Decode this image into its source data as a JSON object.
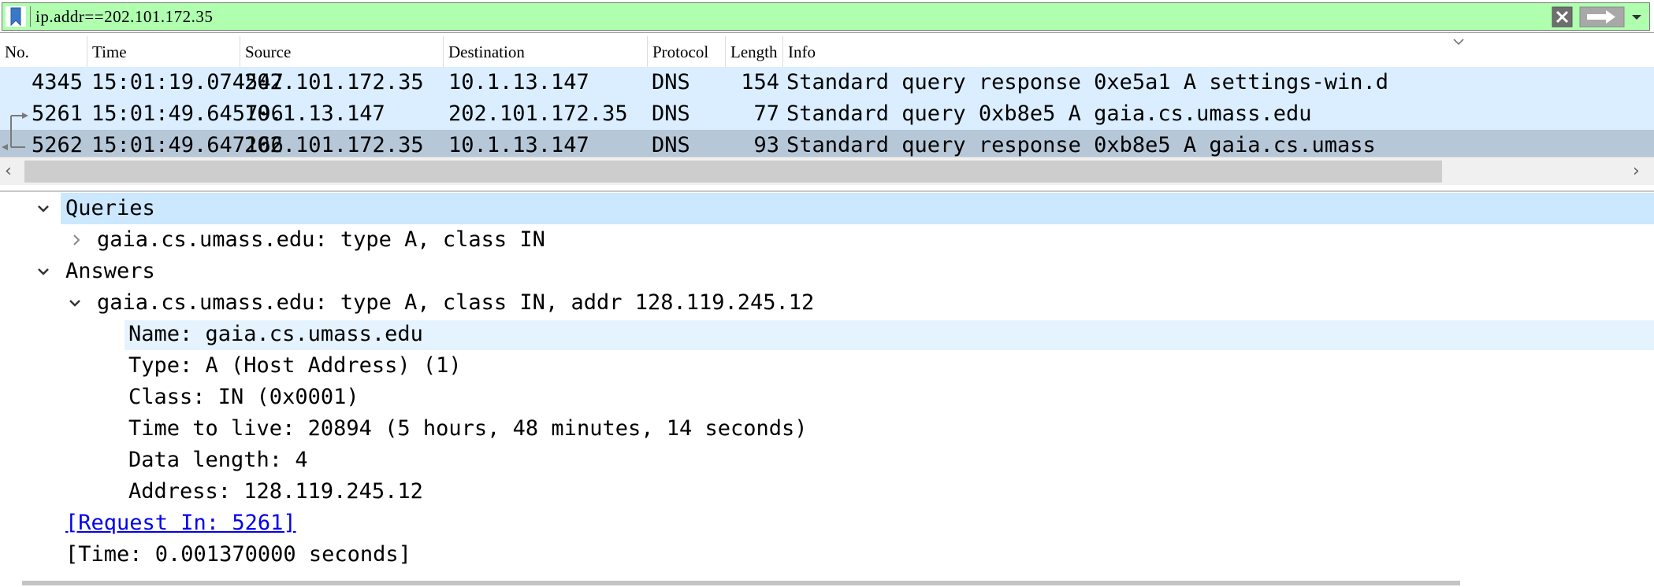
{
  "filter": {
    "value": "ip.addr==202.101.172.35",
    "bookmark_icon": "bookmark-icon",
    "clear_icon": "clear-x-icon",
    "apply_icon": "arrow-right-icon",
    "dropdown_icon": "chevron-down-icon",
    "color": "#afffaf"
  },
  "packet_list": {
    "columns": [
      "No.",
      "Time",
      "Source",
      "Destination",
      "Protocol",
      "Length",
      "Info"
    ],
    "rows": [
      {
        "no": "4345",
        "time": "15:01:19.074547",
        "source": "202.101.172.35",
        "destination": "10.1.13.147",
        "protocol": "DNS",
        "length": "154",
        "info": "Standard query response 0xe5a1 A settings-win.d"
      },
      {
        "no": "5261",
        "time": "15:01:49.645796",
        "source": "10.1.13.147",
        "destination": "202.101.172.35",
        "protocol": "DNS",
        "length": "77",
        "info": "Standard query 0xb8e5 A gaia.cs.umass.edu"
      },
      {
        "no": "5262",
        "time": "15:01:49.647166",
        "source": "202.101.172.35",
        "destination": "10.1.13.147",
        "protocol": "DNS",
        "length": "93",
        "info": "Standard query response 0xb8e5 A gaia.cs.umass"
      }
    ]
  },
  "details": {
    "queries_label": "Queries",
    "query_item": "gaia.cs.umass.edu: type A, class IN",
    "answers_label": "Answers",
    "answer_item": "gaia.cs.umass.edu: type A, class IN, addr 128.119.245.12",
    "fields": [
      "Name: gaia.cs.umass.edu",
      "Type: A (Host Address) (1)",
      "Class: IN (0x0001)",
      "Time to live: 20894 (5 hours, 48 minutes, 14 seconds)",
      "Data length: 4",
      "Address: 128.119.245.12"
    ],
    "request_in": "[Request In: 5261]",
    "time": "[Time: 0.001370000 seconds]"
  },
  "colors": {
    "row_bg": "#daeeff",
    "selected_row_bg": "#b6c8d8",
    "tree_selected_bg": "#cce8ff",
    "link": "#0000ee"
  }
}
